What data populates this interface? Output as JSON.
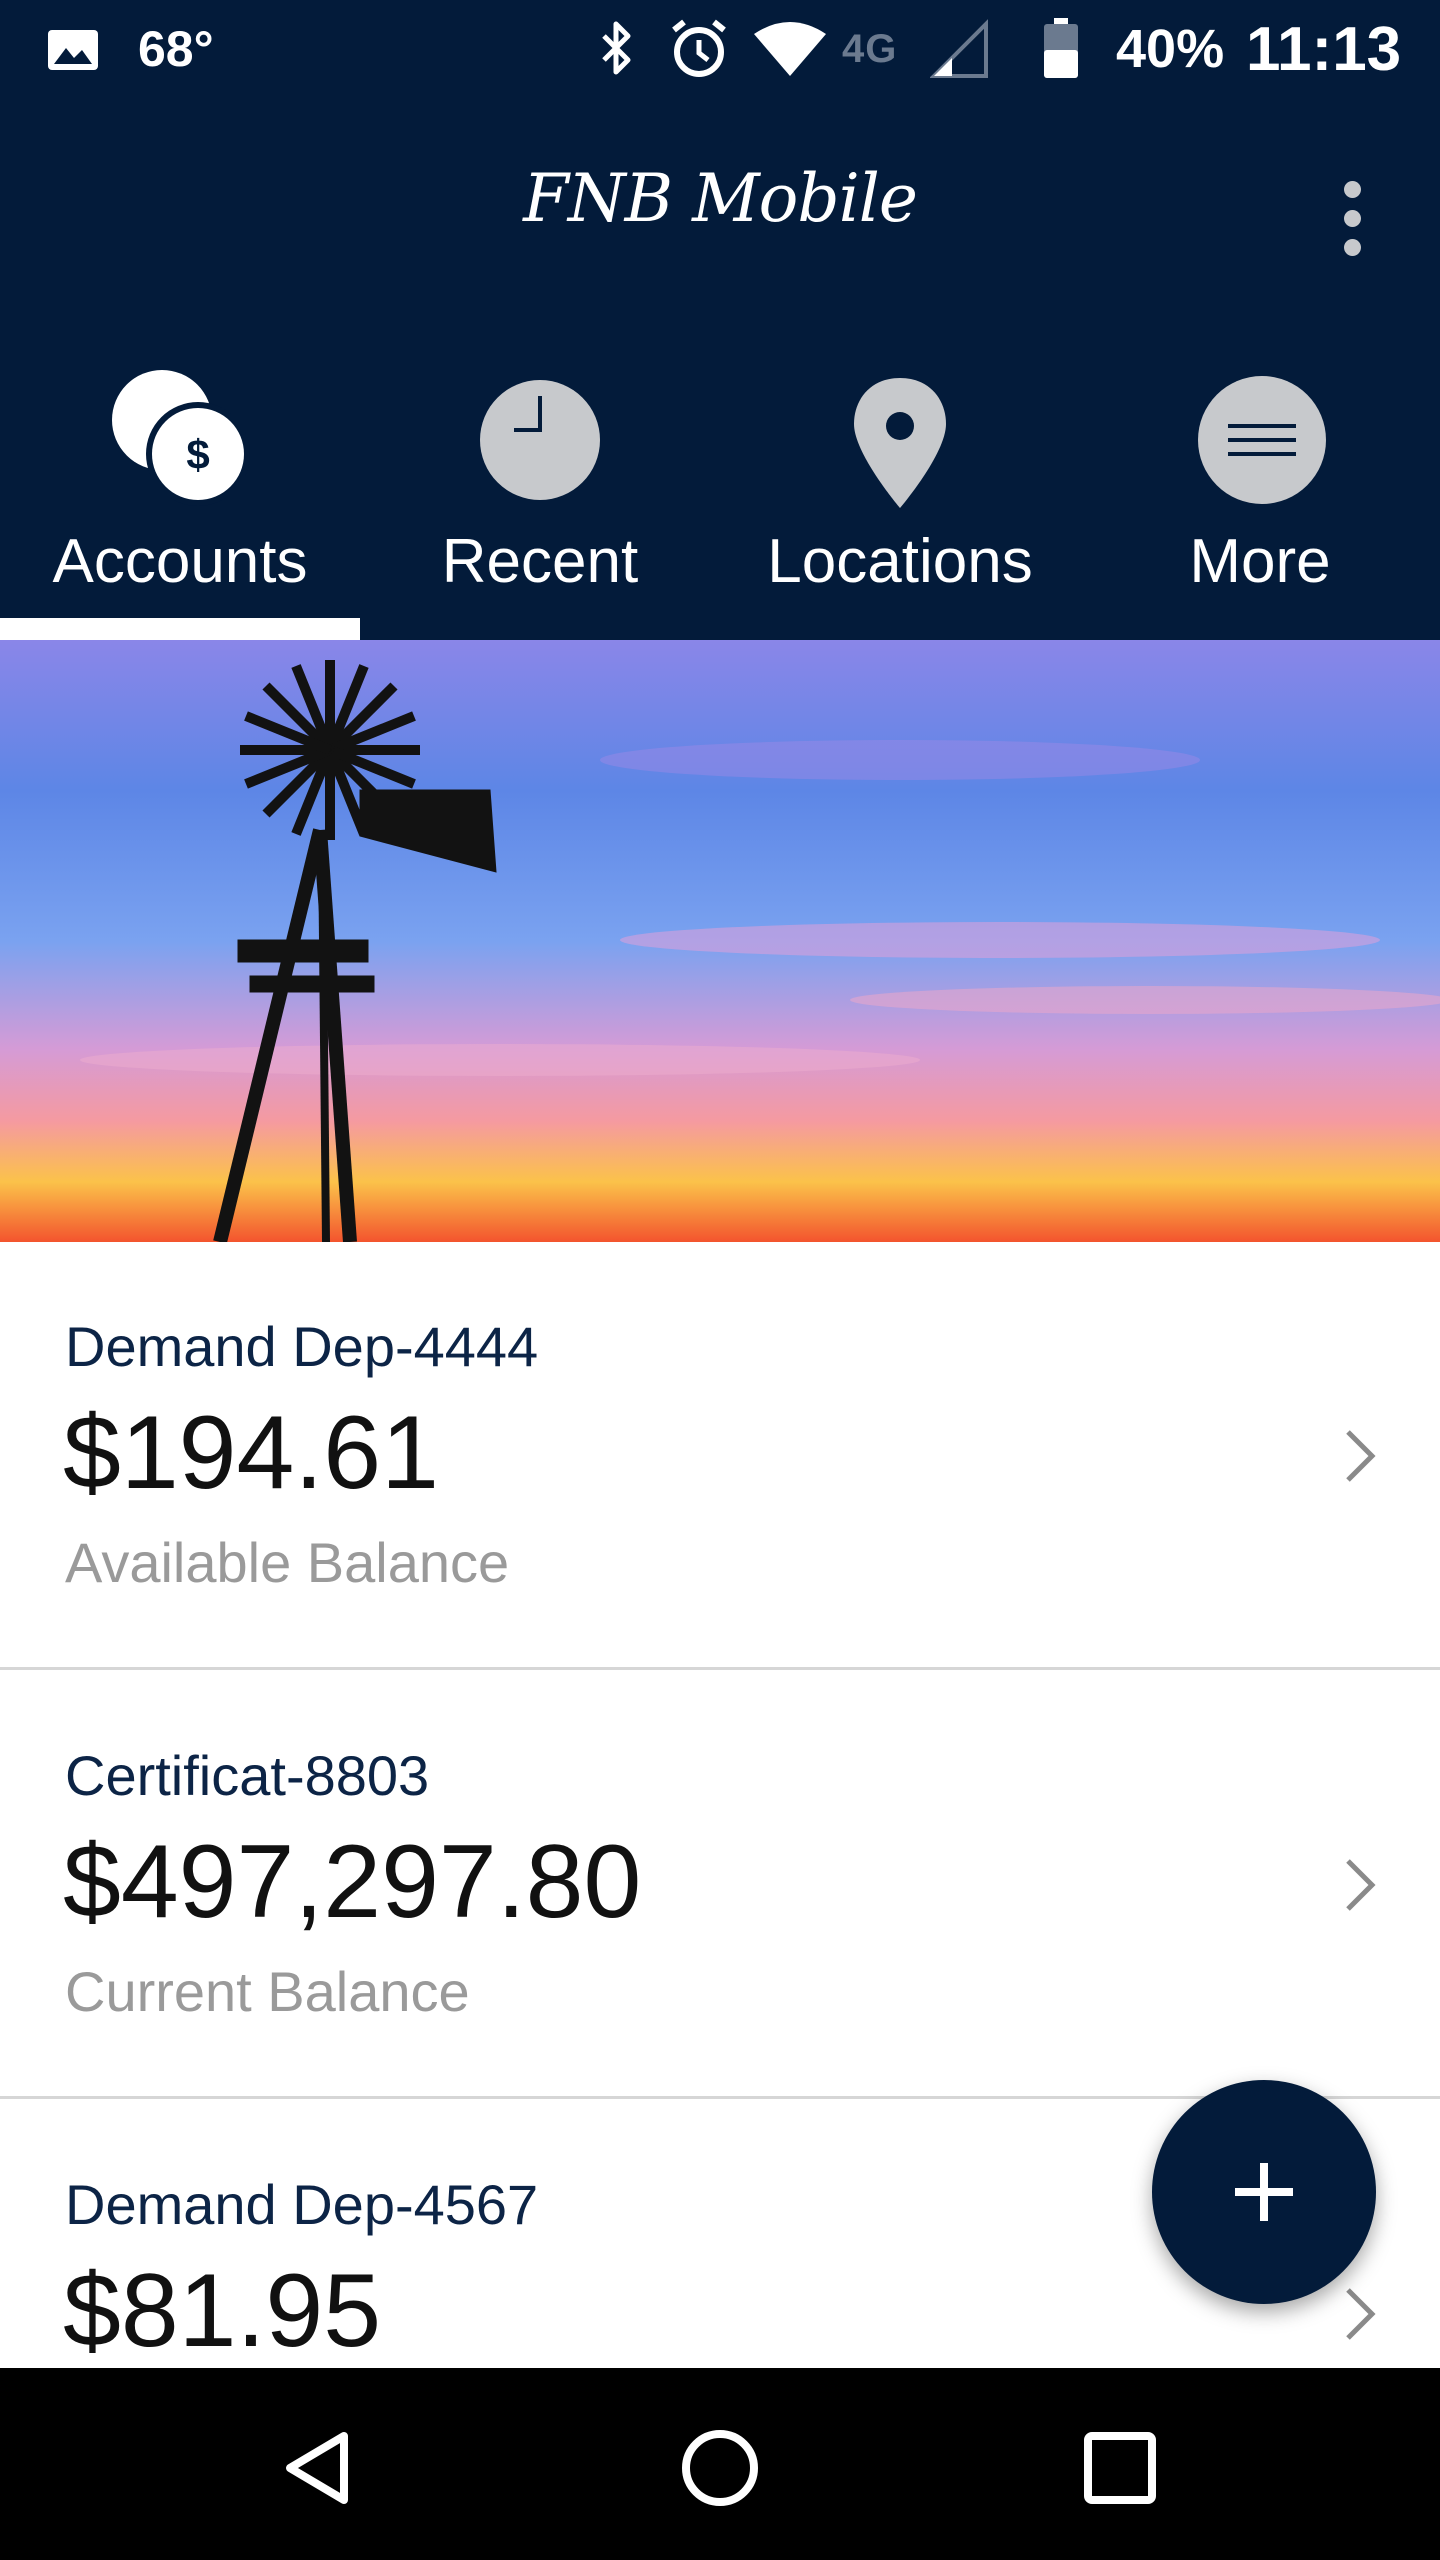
{
  "status_bar": {
    "temperature": "68°",
    "network": "4G",
    "battery_percent": "40%",
    "time": "11:13",
    "icons": [
      "image-icon",
      "bluetooth-icon",
      "alarm-icon",
      "wifi-icon",
      "signal-icon",
      "battery-icon"
    ]
  },
  "app_bar": {
    "title": "FNB Mobile",
    "menu_icon": "more-vertical-icon"
  },
  "tabs": [
    {
      "label": "Accounts",
      "icon": "accounts-coins-icon",
      "selected": true
    },
    {
      "label": "Recent",
      "icon": "clock-icon",
      "selected": false
    },
    {
      "label": "Locations",
      "icon": "location-pin-icon",
      "selected": false
    },
    {
      "label": "More",
      "icon": "menu-lines-icon",
      "selected": false
    }
  ],
  "banner": {
    "icon": "windmill-sunset-image"
  },
  "accounts": [
    {
      "name": "Demand Dep-4444",
      "amount": "$194.61",
      "caption": "Available Balance"
    },
    {
      "name": "Certificat-8803",
      "amount": "$497,297.80",
      "caption": "Current Balance"
    },
    {
      "name": "Demand Dep-4567",
      "amount": "$81.95",
      "caption": ""
    }
  ],
  "fab": {
    "icon": "plus-icon"
  },
  "nav_bar": {
    "icons": [
      "back-icon",
      "home-icon",
      "recents-icon"
    ]
  },
  "colors": {
    "primary": "#031b3a",
    "account_name": "#0c2446",
    "caption": "#9a9a9a",
    "tab_icon_gray": "#c7c9cc"
  }
}
